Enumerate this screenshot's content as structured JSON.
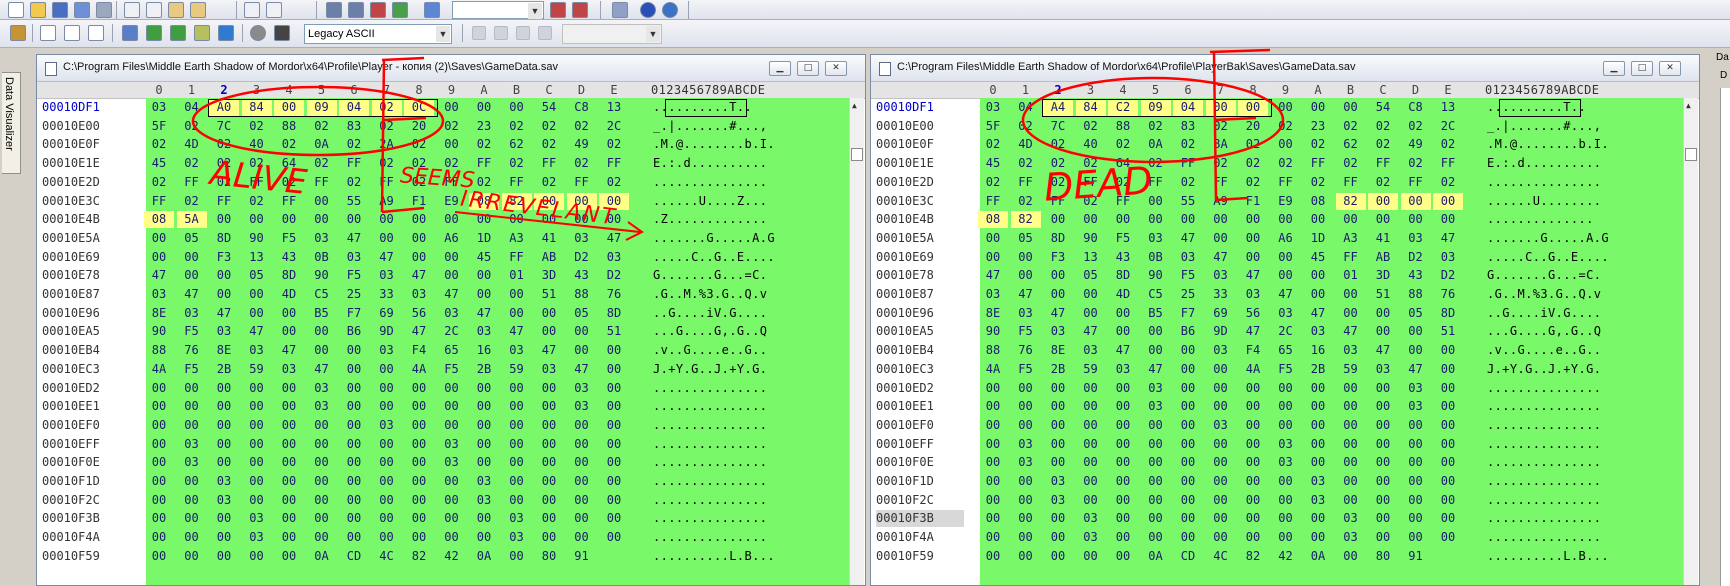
{
  "toolbar": {
    "encoding": "Legacy ASCII",
    "colors": {
      "accent_blue": "#0000c8",
      "bytes_bg": "#79f86a",
      "modified_bg": "#ffff88"
    }
  },
  "sidebar": {
    "data_visualizer_tab": "Data Visualizer"
  },
  "right_panel": {
    "label_top": "Da",
    "label_second": "D"
  },
  "hex_header": {
    "cols": [
      "0",
      "1",
      "2",
      "3",
      "4",
      "5",
      "6",
      "7",
      "8",
      "9",
      "A",
      "B",
      "C",
      "D",
      "E"
    ],
    "ascii": "0123456789ABCDE"
  },
  "left_pane": {
    "title": "C:\\Program Files\\Middle Earth Shadow of Mordor\\x64\\Profile\\Player - копия (2)\\Saves\\GameData.sav",
    "annotations": {
      "alive": "ALIVE",
      "seems": "SEEMS",
      "irrelevant": "IRREVELANT"
    },
    "rows": [
      {
        "offset": "00010DF1",
        "bytes": [
          "03",
          "04",
          "A0",
          "84",
          "00",
          "09",
          "04",
          "02",
          "0C",
          "00",
          "00",
          "00",
          "54",
          "C8",
          "13"
        ],
        "ascii": "..........T.."
      },
      {
        "offset": "00010E00",
        "bytes": [
          "5F",
          "02",
          "7C",
          "02",
          "88",
          "02",
          "83",
          "02",
          "20",
          "02",
          "23",
          "02",
          "02",
          "02",
          "2C"
        ],
        "ascii": "_.|.......#...,"
      },
      {
        "offset": "00010E0F",
        "bytes": [
          "02",
          "4D",
          "02",
          "40",
          "02",
          "0A",
          "02",
          "2A",
          "02",
          "00",
          "02",
          "62",
          "02",
          "49",
          "02"
        ],
        "ascii": ".M.@........b.I."
      },
      {
        "offset": "00010E1E",
        "bytes": [
          "45",
          "02",
          "02",
          "02",
          "64",
          "02",
          "FF",
          "02",
          "02",
          "02",
          "FF",
          "02",
          "FF",
          "02",
          "FF"
        ],
        "ascii": "E.:.d.........."
      },
      {
        "offset": "00010E2D",
        "bytes": [
          "02",
          "FF",
          "02",
          "FF",
          "02",
          "FF",
          "02",
          "FF",
          "02",
          "FF",
          "02",
          "FF",
          "02",
          "FF",
          "02"
        ],
        "ascii": "..............."
      },
      {
        "offset": "00010E3C",
        "bytes": [
          "FF",
          "02",
          "FF",
          "02",
          "FF",
          "00",
          "55",
          "A9",
          "F1",
          "E9",
          "08",
          "82",
          "00",
          "00",
          "00"
        ],
        "ascii": "......U....Z..."
      },
      {
        "offset": "00010E4B",
        "bytes": [
          "08",
          "5A",
          "00",
          "00",
          "00",
          "00",
          "00",
          "00",
          "00",
          "00",
          "00",
          "00",
          "00",
          "00",
          "00"
        ],
        "ascii": ".Z............."
      },
      {
        "offset": "00010E5A",
        "bytes": [
          "00",
          "05",
          "8D",
          "90",
          "F5",
          "03",
          "47",
          "00",
          "00",
          "A6",
          "1D",
          "A3",
          "41",
          "03",
          "47"
        ],
        "ascii": ".......G.....A.G"
      },
      {
        "offset": "00010E69",
        "bytes": [
          "00",
          "00",
          "F3",
          "13",
          "43",
          "0B",
          "03",
          "47",
          "00",
          "00",
          "45",
          "FF",
          "AB",
          "D2",
          "03"
        ],
        "ascii": ".....C..G..E...."
      },
      {
        "offset": "00010E78",
        "bytes": [
          "47",
          "00",
          "00",
          "05",
          "8D",
          "90",
          "F5",
          "03",
          "47",
          "00",
          "00",
          "01",
          "3D",
          "43",
          "D2"
        ],
        "ascii": "G.......G...=C."
      },
      {
        "offset": "00010E87",
        "bytes": [
          "03",
          "47",
          "00",
          "00",
          "4D",
          "C5",
          "25",
          "33",
          "03",
          "47",
          "00",
          "00",
          "51",
          "88",
          "76"
        ],
        "ascii": ".G..M.%3.G..Q.v"
      },
      {
        "offset": "00010E96",
        "bytes": [
          "8E",
          "03",
          "47",
          "00",
          "00",
          "B5",
          "F7",
          "69",
          "56",
          "03",
          "47",
          "00",
          "00",
          "05",
          "8D"
        ],
        "ascii": "..G....iV.G...."
      },
      {
        "offset": "00010EA5",
        "bytes": [
          "90",
          "F5",
          "03",
          "47",
          "00",
          "00",
          "B6",
          "9D",
          "47",
          "2C",
          "03",
          "47",
          "00",
          "00",
          "51"
        ],
        "ascii": "...G....G,.G..Q"
      },
      {
        "offset": "00010EB4",
        "bytes": [
          "88",
          "76",
          "8E",
          "03",
          "47",
          "00",
          "00",
          "03",
          "F4",
          "65",
          "16",
          "03",
          "47",
          "00",
          "00"
        ],
        "ascii": ".v..G....e..G.."
      },
      {
        "offset": "00010EC3",
        "bytes": [
          "4A",
          "F5",
          "2B",
          "59",
          "03",
          "47",
          "00",
          "00",
          "4A",
          "F5",
          "2B",
          "59",
          "03",
          "47",
          "00"
        ],
        "ascii": "J.+Y.G..J.+Y.G."
      },
      {
        "offset": "00010ED2",
        "bytes": [
          "00",
          "00",
          "00",
          "00",
          "00",
          "03",
          "00",
          "00",
          "00",
          "00",
          "00",
          "00",
          "00",
          "03",
          "00"
        ],
        "ascii": "..............."
      },
      {
        "offset": "00010EE1",
        "bytes": [
          "00",
          "00",
          "00",
          "00",
          "00",
          "03",
          "00",
          "00",
          "00",
          "00",
          "00",
          "00",
          "00",
          "03",
          "00"
        ],
        "ascii": "..............."
      },
      {
        "offset": "00010EF0",
        "bytes": [
          "00",
          "00",
          "00",
          "00",
          "00",
          "00",
          "00",
          "03",
          "00",
          "00",
          "00",
          "00",
          "00",
          "00",
          "00"
        ],
        "ascii": "..............."
      },
      {
        "offset": "00010EFF",
        "bytes": [
          "00",
          "03",
          "00",
          "00",
          "00",
          "00",
          "00",
          "00",
          "00",
          "03",
          "00",
          "00",
          "00",
          "00",
          "00"
        ],
        "ascii": "..............."
      },
      {
        "offset": "00010F0E",
        "bytes": [
          "00",
          "03",
          "00",
          "00",
          "00",
          "00",
          "00",
          "00",
          "00",
          "03",
          "00",
          "00",
          "00",
          "00",
          "00"
        ],
        "ascii": "..............."
      },
      {
        "offset": "00010F1D",
        "bytes": [
          "00",
          "00",
          "03",
          "00",
          "00",
          "00",
          "00",
          "00",
          "00",
          "00",
          "03",
          "00",
          "00",
          "00",
          "00"
        ],
        "ascii": "..............."
      },
      {
        "offset": "00010F2C",
        "bytes": [
          "00",
          "00",
          "03",
          "00",
          "00",
          "00",
          "00",
          "00",
          "00",
          "00",
          "03",
          "00",
          "00",
          "00",
          "00"
        ],
        "ascii": "..............."
      },
      {
        "offset": "00010F3B",
        "bytes": [
          "00",
          "00",
          "00",
          "03",
          "00",
          "00",
          "00",
          "00",
          "00",
          "00",
          "00",
          "03",
          "00",
          "00",
          "00"
        ],
        "ascii": "..............."
      },
      {
        "offset": "00010F4A",
        "bytes": [
          "00",
          "00",
          "00",
          "03",
          "00",
          "00",
          "00",
          "00",
          "00",
          "00",
          "00",
          "03",
          "00",
          "00",
          "00"
        ],
        "ascii": "..............."
      },
      {
        "offset": "00010F59",
        "bytes": [
          "00",
          "00",
          "00",
          "00",
          "00",
          "0A",
          "CD",
          "4C",
          "82",
          "42",
          "0A",
          "00",
          "80",
          "91",
          ""
        ],
        "ascii": "..........L.B..."
      }
    ]
  },
  "right_pane": {
    "title": "C:\\Program Files\\Middle Earth Shadow of Mordor\\x64\\Profile\\PlayerBak\\Saves\\GameData.sav",
    "annotations": {
      "dead": "DEAD"
    },
    "rows": [
      {
        "offset": "00010DF1",
        "bytes": [
          "03",
          "04",
          "A4",
          "84",
          "C2",
          "09",
          "04",
          "00",
          "00",
          "00",
          "00",
          "00",
          "54",
          "C8",
          "13"
        ],
        "ascii": "..........T.."
      },
      {
        "offset": "00010E00",
        "bytes": [
          "5F",
          "02",
          "7C",
          "02",
          "88",
          "02",
          "83",
          "02",
          "20",
          "02",
          "23",
          "02",
          "02",
          "02",
          "2C"
        ],
        "ascii": "_.|.......#...,"
      },
      {
        "offset": "00010E0F",
        "bytes": [
          "02",
          "4D",
          "02",
          "40",
          "02",
          "0A",
          "02",
          "8A",
          "02",
          "00",
          "02",
          "62",
          "02",
          "49",
          "02"
        ],
        "ascii": ".M.@........b.I."
      },
      {
        "offset": "00010E1E",
        "bytes": [
          "45",
          "02",
          "02",
          "02",
          "64",
          "02",
          "FF",
          "02",
          "02",
          "02",
          "FF",
          "02",
          "FF",
          "02",
          "FF"
        ],
        "ascii": "E.:.d.........."
      },
      {
        "offset": "00010E2D",
        "bytes": [
          "02",
          "FF",
          "02",
          "FF",
          "02",
          "FF",
          "02",
          "FF",
          "02",
          "FF",
          "02",
          "FF",
          "02",
          "FF",
          "02"
        ],
        "ascii": "..............."
      },
      {
        "offset": "00010E3C",
        "bytes": [
          "FF",
          "02",
          "FF",
          "02",
          "FF",
          "00",
          "55",
          "A9",
          "F1",
          "E9",
          "08",
          "82",
          "00",
          "00",
          "00"
        ],
        "ascii": "......U........"
      },
      {
        "offset": "00010E4B",
        "bytes": [
          "08",
          "82",
          "00",
          "00",
          "00",
          "00",
          "00",
          "00",
          "00",
          "00",
          "00",
          "00",
          "00",
          "00",
          "00"
        ],
        "ascii": ".............."
      },
      {
        "offset": "00010E5A",
        "bytes": [
          "00",
          "05",
          "8D",
          "90",
          "F5",
          "03",
          "47",
          "00",
          "00",
          "A6",
          "1D",
          "A3",
          "41",
          "03",
          "47"
        ],
        "ascii": ".......G.....A.G"
      },
      {
        "offset": "00010E69",
        "bytes": [
          "00",
          "00",
          "F3",
          "13",
          "43",
          "0B",
          "03",
          "47",
          "00",
          "00",
          "45",
          "FF",
          "AB",
          "D2",
          "03"
        ],
        "ascii": ".....C..G..E...."
      },
      {
        "offset": "00010E78",
        "bytes": [
          "47",
          "00",
          "00",
          "05",
          "8D",
          "90",
          "F5",
          "03",
          "47",
          "00",
          "00",
          "01",
          "3D",
          "43",
          "D2"
        ],
        "ascii": "G.......G...=C."
      },
      {
        "offset": "00010E87",
        "bytes": [
          "03",
          "47",
          "00",
          "00",
          "4D",
          "C5",
          "25",
          "33",
          "03",
          "47",
          "00",
          "00",
          "51",
          "88",
          "76"
        ],
        "ascii": ".G..M.%3.G..Q.v"
      },
      {
        "offset": "00010E96",
        "bytes": [
          "8E",
          "03",
          "47",
          "00",
          "00",
          "B5",
          "F7",
          "69",
          "56",
          "03",
          "47",
          "00",
          "00",
          "05",
          "8D"
        ],
        "ascii": "..G....iV.G...."
      },
      {
        "offset": "00010EA5",
        "bytes": [
          "90",
          "F5",
          "03",
          "47",
          "00",
          "00",
          "B6",
          "9D",
          "47",
          "2C",
          "03",
          "47",
          "00",
          "00",
          "51"
        ],
        "ascii": "...G....G,.G..Q"
      },
      {
        "offset": "00010EB4",
        "bytes": [
          "88",
          "76",
          "8E",
          "03",
          "47",
          "00",
          "00",
          "03",
          "F4",
          "65",
          "16",
          "03",
          "47",
          "00",
          "00"
        ],
        "ascii": ".v..G....e..G.."
      },
      {
        "offset": "00010EC3",
        "bytes": [
          "4A",
          "F5",
          "2B",
          "59",
          "03",
          "47",
          "00",
          "00",
          "4A",
          "F5",
          "2B",
          "59",
          "03",
          "47",
          "00"
        ],
        "ascii": "J.+Y.G..J.+Y.G."
      },
      {
        "offset": "00010ED2",
        "bytes": [
          "00",
          "00",
          "00",
          "00",
          "00",
          "03",
          "00",
          "00",
          "00",
          "00",
          "00",
          "00",
          "00",
          "03",
          "00"
        ],
        "ascii": "..............."
      },
      {
        "offset": "00010EE1",
        "bytes": [
          "00",
          "00",
          "00",
          "00",
          "00",
          "03",
          "00",
          "00",
          "00",
          "00",
          "00",
          "00",
          "00",
          "03",
          "00"
        ],
        "ascii": "..............."
      },
      {
        "offset": "00010EF0",
        "bytes": [
          "00",
          "00",
          "00",
          "00",
          "00",
          "00",
          "00",
          "03",
          "00",
          "00",
          "00",
          "00",
          "00",
          "00",
          "00"
        ],
        "ascii": "..............."
      },
      {
        "offset": "00010EFF",
        "bytes": [
          "00",
          "03",
          "00",
          "00",
          "00",
          "00",
          "00",
          "00",
          "00",
          "03",
          "00",
          "00",
          "00",
          "00",
          "00"
        ],
        "ascii": "..............."
      },
      {
        "offset": "00010F0E",
        "bytes": [
          "00",
          "03",
          "00",
          "00",
          "00",
          "00",
          "00",
          "00",
          "00",
          "03",
          "00",
          "00",
          "00",
          "00",
          "00"
        ],
        "ascii": "..............."
      },
      {
        "offset": "00010F1D",
        "bytes": [
          "00",
          "00",
          "03",
          "00",
          "00",
          "00",
          "00",
          "00",
          "00",
          "00",
          "03",
          "00",
          "00",
          "00",
          "00"
        ],
        "ascii": "..............."
      },
      {
        "offset": "00010F2C",
        "bytes": [
          "00",
          "00",
          "03",
          "00",
          "00",
          "00",
          "00",
          "00",
          "00",
          "00",
          "03",
          "00",
          "00",
          "00",
          "00"
        ],
        "ascii": "..............."
      },
      {
        "offset": "00010F3B",
        "bytes": [
          "00",
          "00",
          "00",
          "03",
          "00",
          "00",
          "00",
          "00",
          "00",
          "00",
          "00",
          "03",
          "00",
          "00",
          "00"
        ],
        "ascii": "..............."
      },
      {
        "offset": "00010F4A",
        "bytes": [
          "00",
          "00",
          "00",
          "03",
          "00",
          "00",
          "00",
          "00",
          "00",
          "00",
          "00",
          "03",
          "00",
          "00",
          "00"
        ],
        "ascii": "..............."
      },
      {
        "offset": "00010F59",
        "bytes": [
          "00",
          "00",
          "00",
          "00",
          "00",
          "0A",
          "CD",
          "4C",
          "82",
          "42",
          "0A",
          "00",
          "80",
          "91",
          ""
        ],
        "ascii": "..........L.B..."
      }
    ]
  }
}
